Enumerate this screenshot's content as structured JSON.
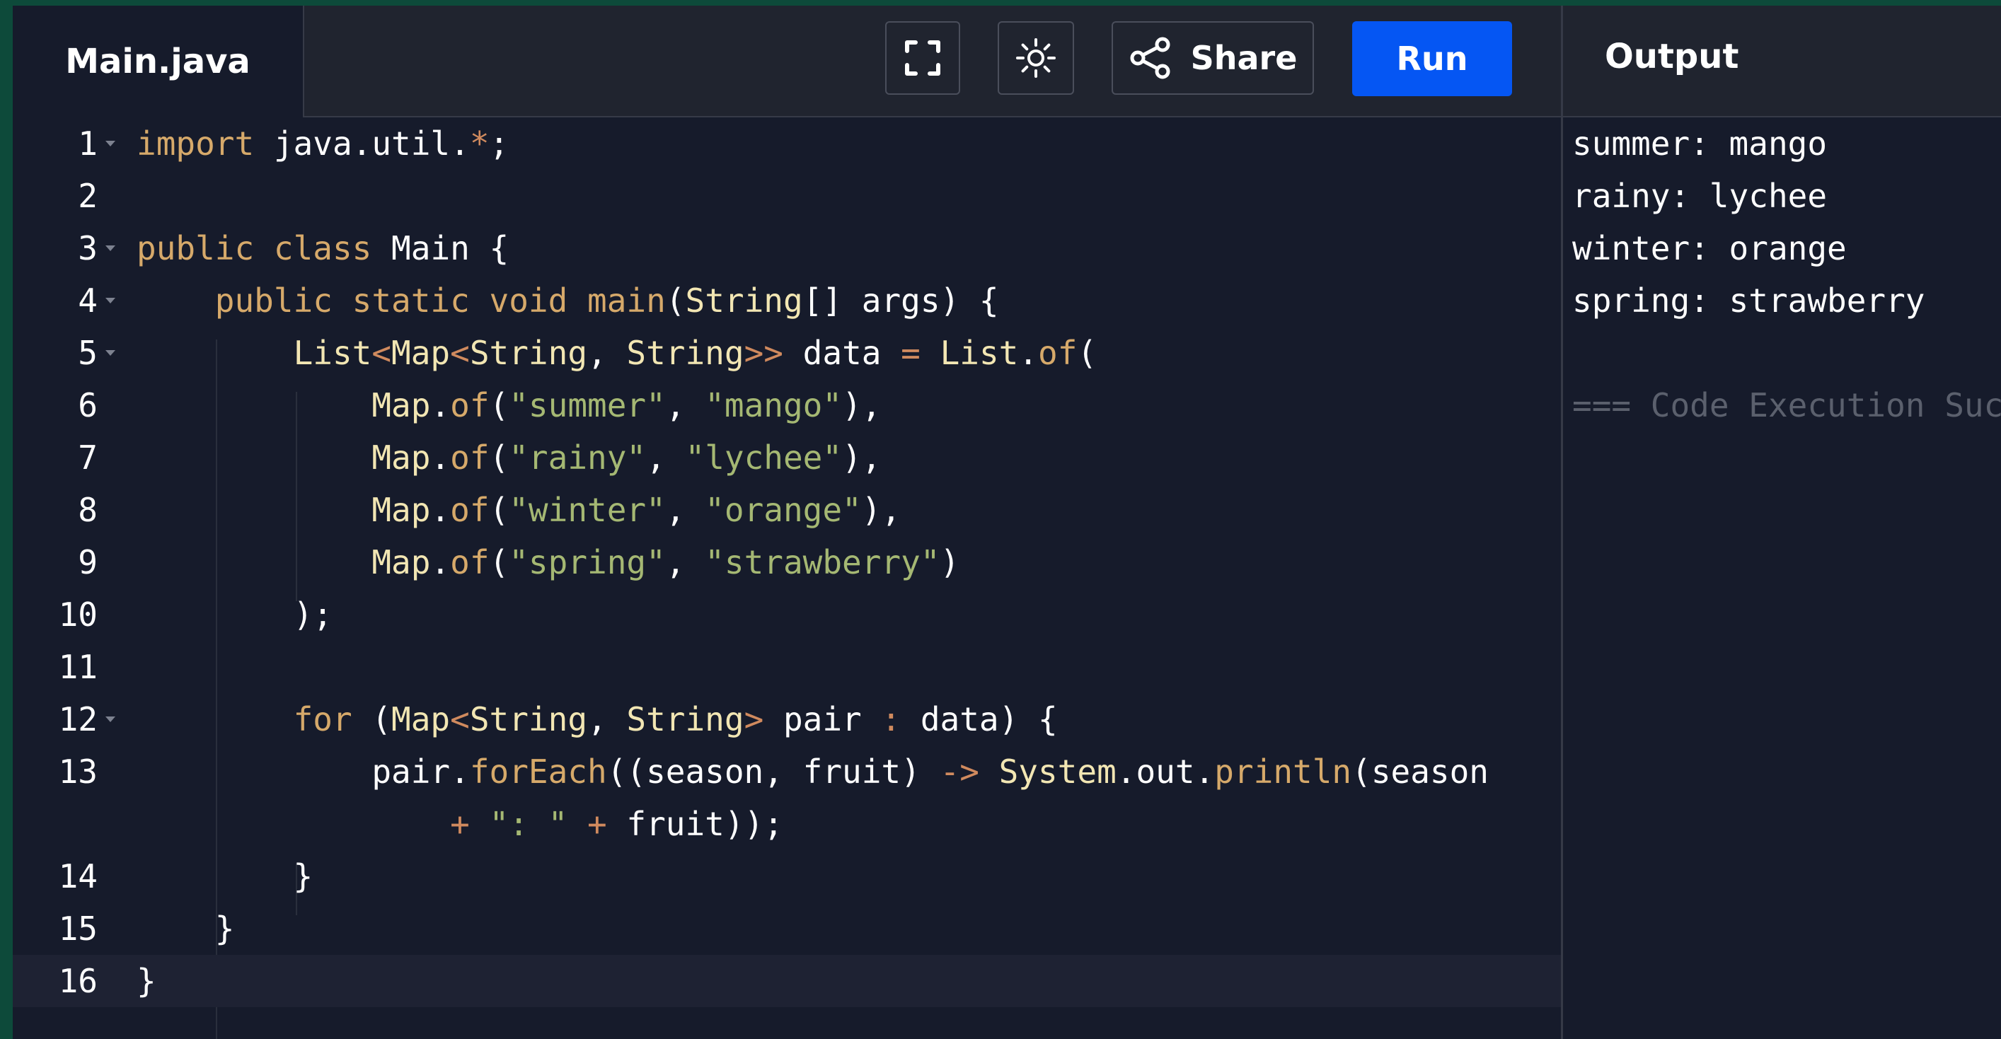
{
  "header": {
    "file_name": "Main.java",
    "fullscreen_icon": "fullscreen-icon",
    "theme_icon": "sun-icon",
    "share_icon": "share-icon",
    "share_label": "Share",
    "run_label": "Run",
    "output_title": "Output"
  },
  "editor": {
    "line_numbers": [
      "1",
      "2",
      "3",
      "4",
      "5",
      "6",
      "7",
      "8",
      "9",
      "10",
      "11",
      "12",
      "13",
      "",
      "14",
      "15",
      "16"
    ],
    "lines": [
      "import java.util.*;",
      "",
      "public class Main {",
      "    public static void main(String[] args) {",
      "        List<Map<String, String>> data = List.of(",
      "            Map.of(\"summer\", \"mango\"),",
      "            Map.of(\"rainy\", \"lychee\"),",
      "            Map.of(\"winter\", \"orange\"),",
      "            Map.of(\"spring\", \"strawberry\")",
      "        );",
      "",
      "        for (Map<String, String> pair : data) {",
      "            pair.forEach((season, fruit) -> System.out.println(season",
      "                + \": \" + fruit));",
      "        }",
      "    }",
      "}"
    ]
  },
  "output": {
    "lines": [
      "summer: mango",
      "rainy: lychee",
      "winter: orange",
      "spring: strawberry"
    ],
    "status": "=== Code Execution Suc"
  },
  "colors": {
    "run_button": "#0556f3",
    "keyword": "#d6a96a",
    "string": "#a5b873",
    "editor_bg": "#161b2b"
  }
}
